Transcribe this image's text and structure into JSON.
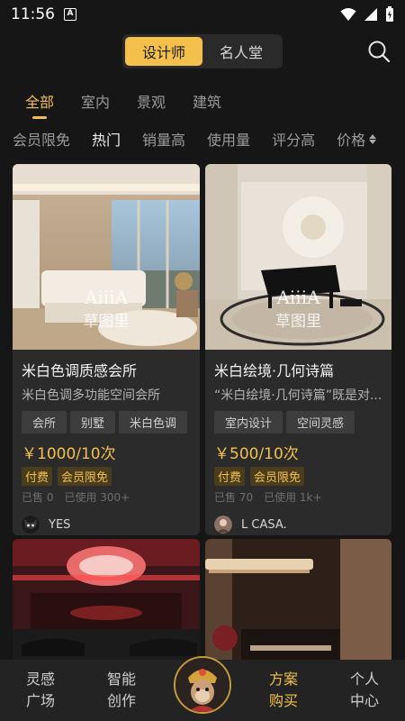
{
  "status_bar": {
    "time": "11:56",
    "a_indicator": "A"
  },
  "header": {
    "segments": [
      "设计师",
      "名人堂"
    ],
    "active_segment": 0,
    "search_icon": "search-icon"
  },
  "category_tabs": [
    "全部",
    "室内",
    "景观",
    "建筑"
  ],
  "sort_options": [
    "会员限免",
    "热门",
    "销量高",
    "使用量",
    "评分高",
    "价格"
  ],
  "cards": [
    {
      "watermark_top": "AiiiA",
      "watermark_bottom": "草图里",
      "title": "米白色调质感会所",
      "desc": "米白色调多功能空间会所",
      "tags": [
        "会所",
        "别墅",
        "米白色调"
      ],
      "price": "￥1000/10次",
      "badges": [
        "付费",
        "会员限免"
      ],
      "sold": "已售 0",
      "used": "已使用 300+",
      "author": "YES"
    },
    {
      "watermark_top": "AiiiA",
      "watermark_bottom": "草图里",
      "title": "米白绘境·几何诗篇",
      "desc": "“米白绘境·几何诗篇”既是对...",
      "tags": [
        "室内设计",
        "空间灵感"
      ],
      "price": "￥500/10次",
      "badges": [
        "付费",
        "会员限免"
      ],
      "sold": "已售 70",
      "used": "已使用 1k+",
      "author": "L CASA."
    }
  ],
  "bottom_nav": {
    "items": [
      "灵感\n广场",
      "智能\n创作",
      "方案\n购买",
      "个人\n中心"
    ],
    "active": 2
  },
  "colors": {
    "accent": "#f3c04c",
    "background": "#161616",
    "card": "#2b2b2b"
  }
}
